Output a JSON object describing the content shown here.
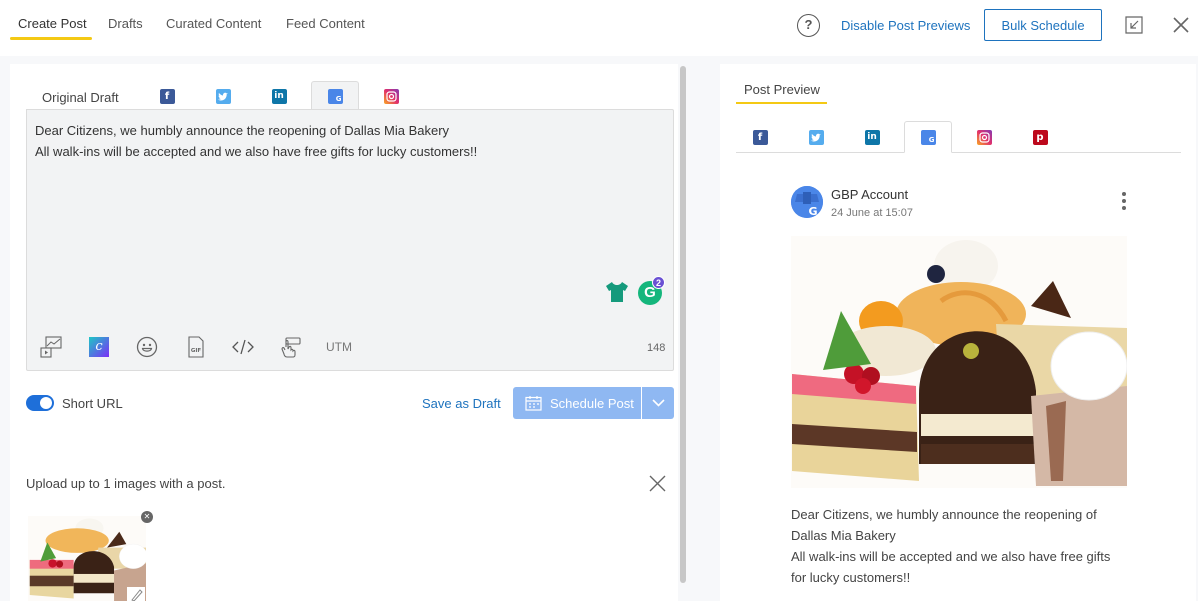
{
  "top_tabs": [
    {
      "label": "Create Post",
      "active": true
    },
    {
      "label": "Drafts",
      "active": false
    },
    {
      "label": "Curated Content",
      "active": false
    },
    {
      "label": "Feed Content",
      "active": false
    }
  ],
  "header": {
    "help_icon": "question-circle-icon",
    "disable_previews_label": "Disable Post Previews",
    "bulk_schedule_label": "Bulk Schedule",
    "minimize_icon": "minimize-icon",
    "close_icon": "close-icon"
  },
  "composer": {
    "draft_tab_label": "Original Draft",
    "network_tabs": [
      {
        "network": "facebook",
        "icon": "facebook-icon",
        "color": "#3b5998",
        "active": false
      },
      {
        "network": "twitter",
        "icon": "twitter-icon",
        "color": "#55acee",
        "active": false
      },
      {
        "network": "linkedin",
        "icon": "linkedin-icon",
        "color": "#0e76a8",
        "active": false
      },
      {
        "network": "google-business",
        "icon": "google-business-icon",
        "color": "#4a86e8",
        "active": true
      },
      {
        "network": "instagram",
        "icon": "instagram-icon",
        "color": "#e1306c",
        "active": false
      }
    ],
    "text": "Dear Citizens, we humbly announce the reopening of Dallas Mia Bakery\nAll walk-ins will be accepted and we also have free gifts for lucky customers!!",
    "grammarly_badge": "2",
    "toolbar": [
      {
        "icon": "media-library-icon"
      },
      {
        "icon": "canva-icon"
      },
      {
        "icon": "emoji-icon"
      },
      {
        "icon": "gif-icon"
      },
      {
        "icon": "code-icon"
      },
      {
        "icon": "hand-pointer-icon"
      }
    ],
    "utm_label": "UTM",
    "char_count": "148"
  },
  "actions": {
    "short_url_label": "Short URL",
    "short_url_enabled": true,
    "save_draft_label": "Save as Draft",
    "schedule_label": "Schedule Post"
  },
  "upload": {
    "label": "Upload up to 1 images with a post.",
    "image_alt": "Assorted pastries"
  },
  "preview": {
    "title": "Post Preview",
    "tabs": [
      {
        "network": "facebook",
        "icon": "facebook-icon",
        "color": "#3b5998",
        "active": false
      },
      {
        "network": "twitter",
        "icon": "twitter-icon",
        "color": "#55acee",
        "active": false
      },
      {
        "network": "linkedin",
        "icon": "linkedin-icon",
        "color": "#0e76a8",
        "active": false
      },
      {
        "network": "google-business",
        "icon": "google-business-icon",
        "color": "#4a86e8",
        "active": true
      },
      {
        "network": "instagram",
        "icon": "instagram-icon",
        "color": "#e1306c",
        "active": false
      },
      {
        "network": "pinterest",
        "icon": "pinterest-icon",
        "color": "#bd081c",
        "active": false
      }
    ],
    "account_name": "GBP Account",
    "date": "24 June at 15:07",
    "text": "Dear Citizens, we humbly announce the reopening of\nDallas Mia Bakery\nAll walk-ins will be accepted and we also have free gifts\nfor lucky customers!!"
  },
  "colors": {
    "accent_yellow": "#f4c914",
    "link_blue": "#1e73be",
    "schedule_disabled": "#8fb8f2"
  }
}
